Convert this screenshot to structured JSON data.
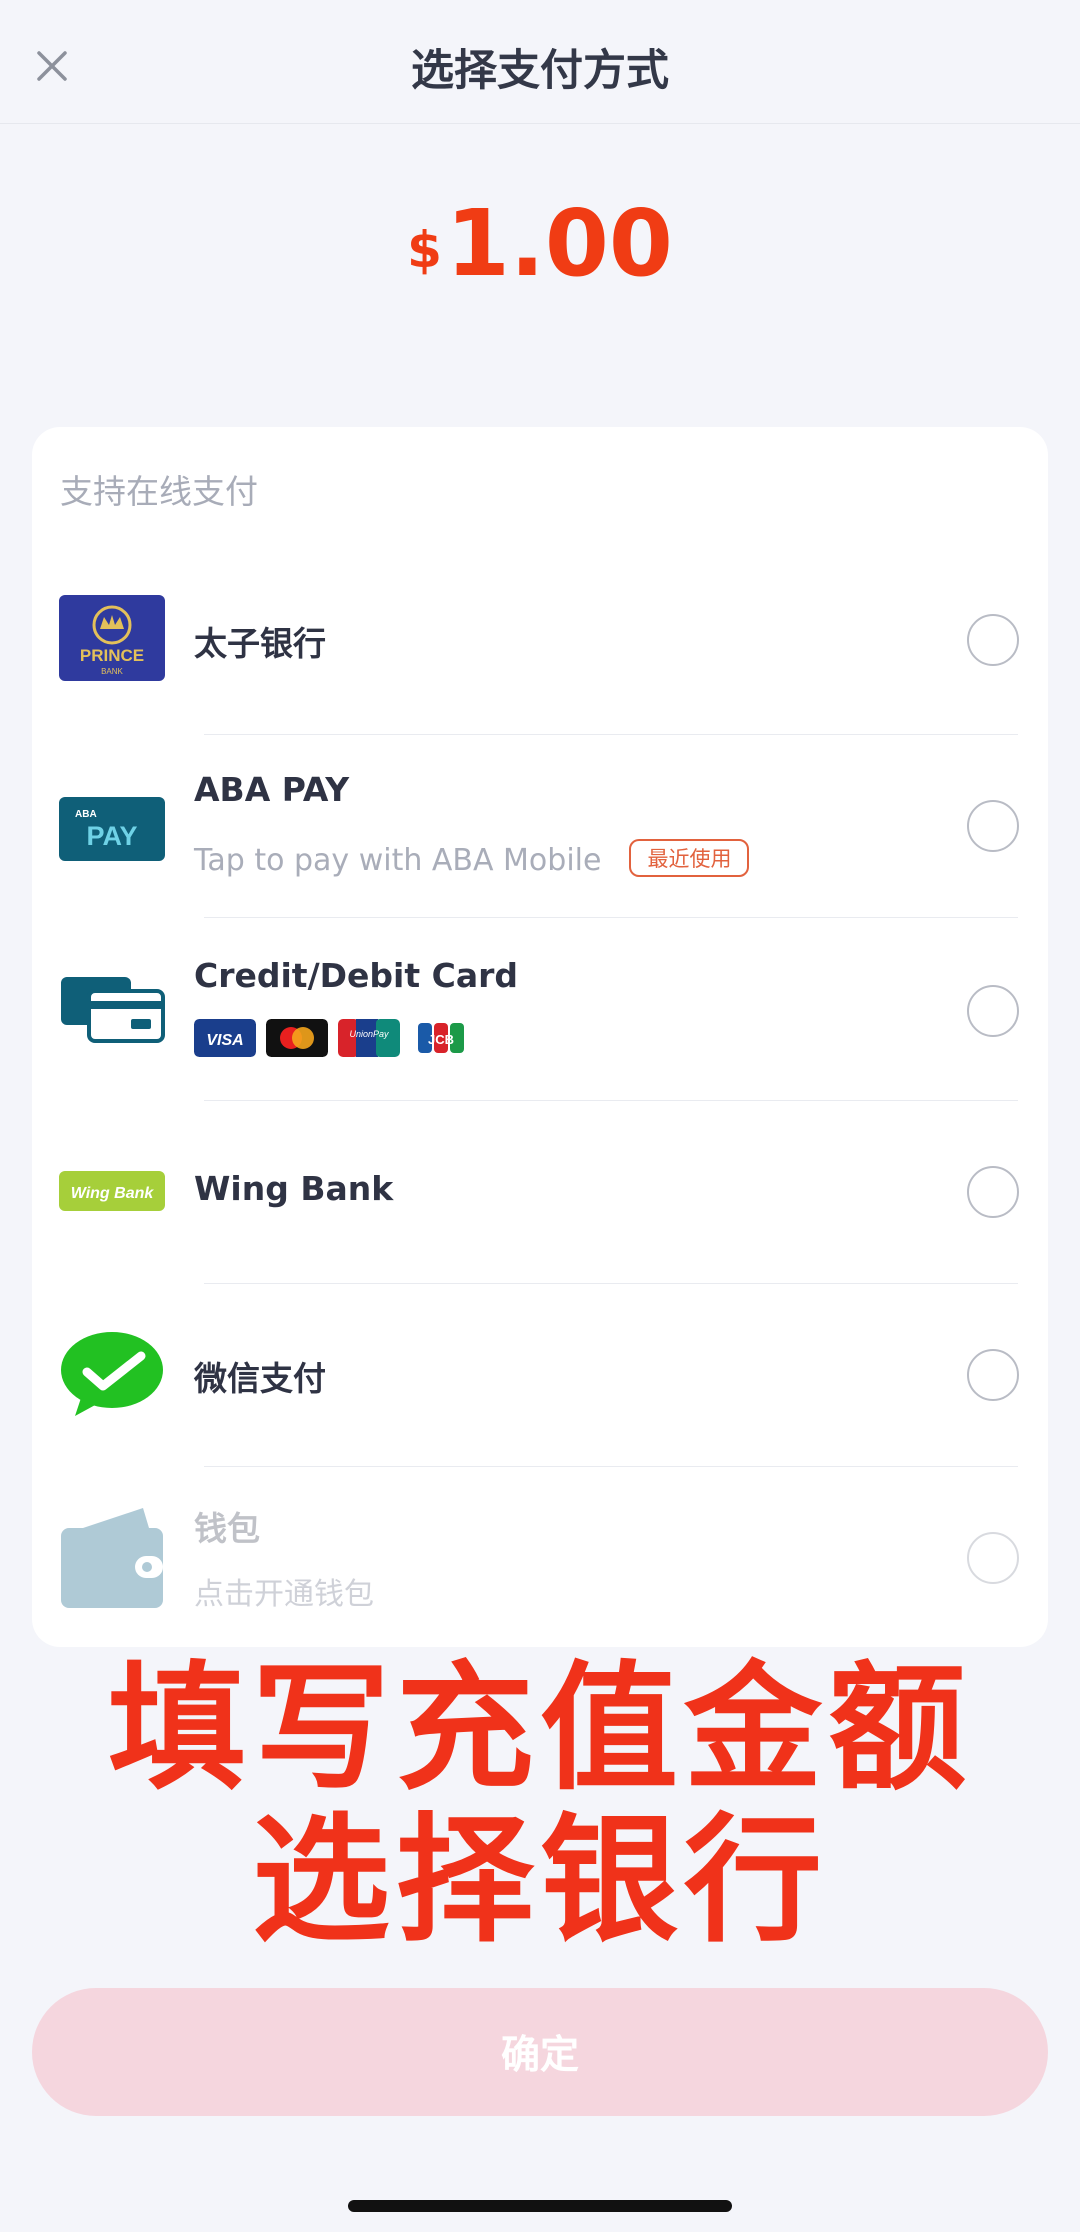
{
  "header": {
    "title": "选择支付方式",
    "close_icon": "close-icon"
  },
  "amount": {
    "currency": "$",
    "value": "1.00"
  },
  "section_label": "支持在线支付",
  "methods": [
    {
      "name": "太子银行",
      "logo_text": "PRINCE",
      "logo_subtext": "BANK",
      "logo_color": "#2f3a9e"
    },
    {
      "name": "ABA PAY",
      "subtitle": "Tap to pay with ABA Mobile",
      "badge": "最近使用",
      "logo_text": "PAY",
      "logo_subtext": "ABA",
      "logo_color": "#0f5f78"
    },
    {
      "name": "Credit/Debit Card",
      "card_brands": [
        "VISA",
        "",
        "UnionPay",
        "JCB"
      ]
    },
    {
      "name": "Wing Bank",
      "logo_text": "Wing Bank",
      "logo_color": "#a6cf3a"
    },
    {
      "name": "微信支付",
      "logo_color": "#22c122"
    },
    {
      "name": "钱包",
      "subtitle": "点击开通钱包",
      "disabled": true,
      "logo_color": "#8fb6c8"
    }
  ],
  "overlay": {
    "line1": "填写充值金额",
    "line2": "选择银行"
  },
  "confirm_label": "确定",
  "colors": {
    "accent": "#f03c14",
    "confirm_disabled": "#f5d6de"
  }
}
